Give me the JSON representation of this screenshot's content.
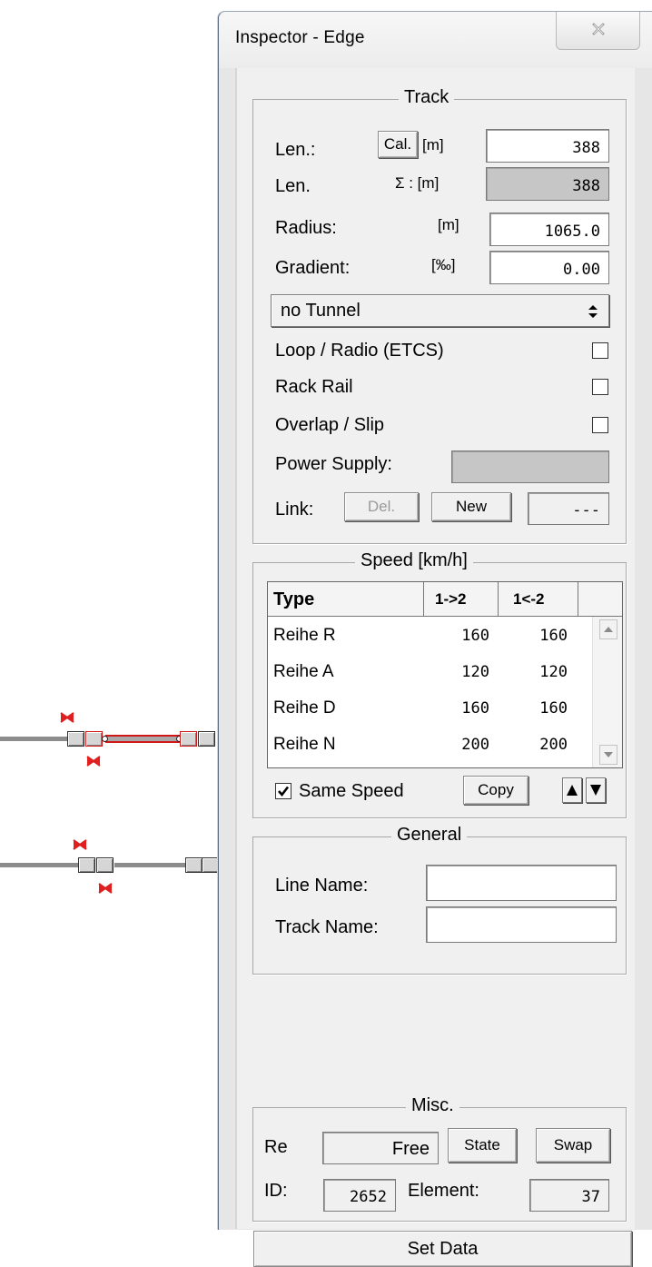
{
  "window": {
    "title": "Inspector - Edge"
  },
  "track": {
    "group_label": "Track",
    "len_label": "Len.:",
    "cal_button": "Cal.",
    "len_unit": "[m]",
    "len_value": "388",
    "len_sum_label": "Len.",
    "len_sum_unit": "Σ : [m]",
    "len_sum_value": "388",
    "radius_label": "Radius:",
    "radius_unit": "[m]",
    "radius_value": "1065.0",
    "gradient_label": "Gradient:",
    "gradient_unit": "[‰]",
    "gradient_value": "0.00",
    "tunnel_selected": "no Tunnel",
    "checkboxes": [
      {
        "label": "Loop / Radio (ETCS)",
        "checked": false
      },
      {
        "label": "Rack Rail",
        "checked": false
      },
      {
        "label": "Overlap / Slip",
        "checked": false
      }
    ],
    "power_supply_label": "Power Supply:",
    "power_supply_value": "",
    "link_label": "Link:",
    "link_del_button": "Del.",
    "link_new_button": "New",
    "link_value": "---"
  },
  "speed": {
    "group_label": "Speed [km/h]",
    "columns": [
      "Type",
      "1->2",
      "1<-2"
    ],
    "rows": [
      {
        "type": "Reihe R",
        "forward": "160",
        "backward": "160"
      },
      {
        "type": "Reihe A",
        "forward": "120",
        "backward": "120"
      },
      {
        "type": "Reihe D",
        "forward": "160",
        "backward": "160"
      },
      {
        "type": "Reihe N",
        "forward": "200",
        "backward": "200"
      }
    ],
    "same_speed_label": "Same Speed",
    "same_speed_checked": true,
    "copy_button": "Copy"
  },
  "general": {
    "group_label": "General",
    "line_name_label": "Line Name:",
    "line_name_value": "",
    "track_name_label": "Track Name:",
    "track_name_value": ""
  },
  "misc": {
    "group_label": "Misc.",
    "re_label": "Re",
    "re_value": "Free",
    "state_button": "State",
    "swap_button": "Swap",
    "id_label": "ID:",
    "id_value": "2652",
    "element_label": "Element:",
    "element_value": "37"
  },
  "set_data_button": "Set Data",
  "colors": {
    "selection_red": "#d01818",
    "marker_red": "#e02020",
    "track_grey": "#8c8c8c",
    "window_bg": "#f0f0f0"
  },
  "icons": {
    "close": "close-x-icon",
    "dropdown": "up-down-arrows-icon",
    "scroll_up": "scroll-up-arrow-icon",
    "scroll_down": "scroll-down-arrow-icon",
    "move_up": "triangle-up-icon",
    "move_down": "triangle-down-icon",
    "track_marker": "red-signal-marker-icon"
  }
}
